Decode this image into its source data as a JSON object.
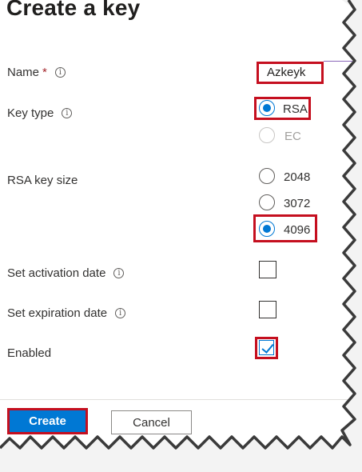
{
  "title": "Create a key",
  "fields": {
    "name": {
      "label": "Name",
      "required_marker": "*",
      "info_glyph": "i",
      "value": "Azkeyk"
    },
    "key_type": {
      "label": "Key type",
      "info_glyph": "i",
      "options": [
        {
          "label": "RSA",
          "selected": true,
          "disabled": false
        },
        {
          "label": "EC",
          "selected": false,
          "disabled": true
        }
      ]
    },
    "rsa_key_size": {
      "label": "RSA key size",
      "options": [
        {
          "label": "2048",
          "selected": false
        },
        {
          "label": "3072",
          "selected": false
        },
        {
          "label": "4096",
          "selected": true
        }
      ]
    },
    "activation": {
      "label": "Set activation date",
      "info_glyph": "i",
      "checked": false
    },
    "expiration": {
      "label": "Set expiration date",
      "info_glyph": "i",
      "checked": false
    },
    "enabled": {
      "label": "Enabled",
      "checked": true
    }
  },
  "footer": {
    "create_label": "Create",
    "cancel_label": "Cancel"
  },
  "colors": {
    "accent": "#0078d4",
    "highlight": "#c50f1f",
    "text": "#323130"
  }
}
